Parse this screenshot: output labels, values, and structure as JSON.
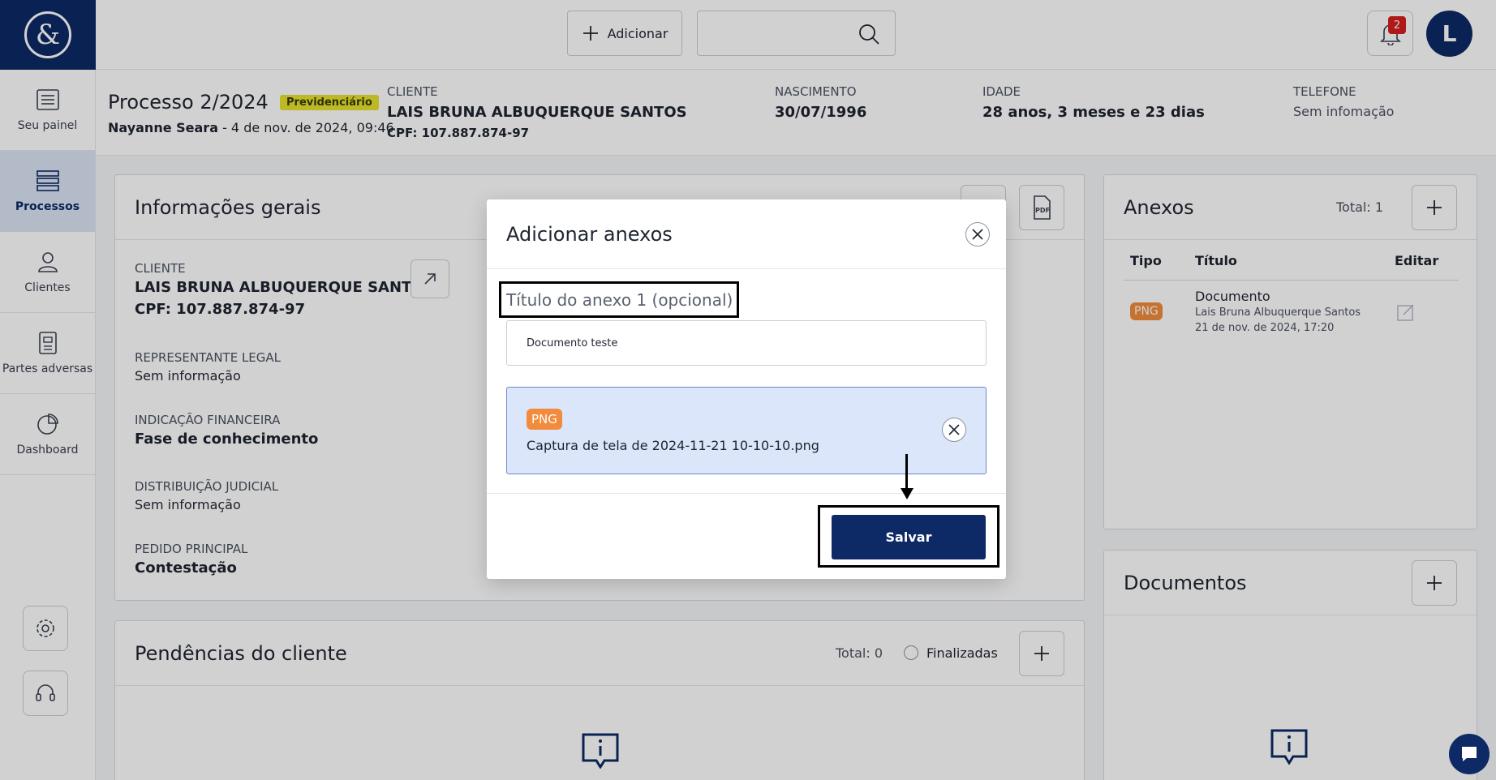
{
  "sidebar": {
    "items": [
      {
        "label": "Seu painel",
        "icon": "dashboard-list-icon"
      },
      {
        "label": "Processos",
        "icon": "stack-icon",
        "active": true
      },
      {
        "label": "Clientes",
        "icon": "person-icon"
      },
      {
        "label": "Partes adversas",
        "icon": "document-icon"
      },
      {
        "label": "Dashboard",
        "icon": "pie-chart-icon"
      }
    ]
  },
  "topbar": {
    "add_label": "Adicionar",
    "search_value": "",
    "notifications_count": "2",
    "avatar_initial": "L"
  },
  "process": {
    "title": "Processo 2/2024",
    "tag": "Previdenciário",
    "author": "Nayanne Seara",
    "date": " - 4 de nov. de 2024, 09:46"
  },
  "header_fields": {
    "cliente_label": "CLIENTE",
    "cliente_name": "LAIS BRUNA ALBUQUERQUE SANTOS",
    "cliente_cpf": "CPF: 107.887.874-97",
    "nascimento_label": "NASCIMENTO",
    "nascimento_value": "30/07/1996",
    "idade_label": "IDADE",
    "idade_value": "28 anos, 3 meses e 23 dias",
    "telefone_label": "TELEFONE",
    "telefone_value": "Sem infomação"
  },
  "info_card": {
    "title": "Informações gerais",
    "cliente_label": "CLIENTE",
    "cliente_name": "LAIS BRUNA ALBUQUERQUE SANTOS",
    "cliente_cpf": "CPF: 107.887.874-97",
    "rep_label": "REPRESENTANTE LEGAL",
    "rep_value": "Sem informação",
    "ind_label": "INDICAÇÃO FINANCEIRA",
    "ind_value": "Fase de conhecimento",
    "dist_label": "DISTRIBUIÇÃO JUDICIAL",
    "dist_value": "Sem informação",
    "pedido_label": "PEDIDO PRINCIPAL",
    "pedido_value": "Contestação"
  },
  "pendencias": {
    "title": "Pendências do cliente",
    "total": "Total: 0",
    "finalizadas": "Finalizadas"
  },
  "anexos": {
    "title": "Anexos",
    "total": "Total: 1",
    "col_tipo": "Tipo",
    "col_titulo": "Título",
    "col_editar": "Editar",
    "row": {
      "type": "PNG",
      "title": "Documento",
      "author": "Lais Bruna Albuquerque Santos",
      "date": "21 de nov. de 2024, 17:20"
    }
  },
  "documentos": {
    "title": "Documentos"
  },
  "modal": {
    "title": "Adicionar anexos",
    "field_label": "Título do anexo 1 (opcional)",
    "field_value": "Documento teste",
    "file_type": "PNG",
    "file_name": "Captura de tela de 2024-11-21 10-10-10.png",
    "save_label": "Salvar"
  },
  "colors": {
    "brand": "#0d2a66",
    "tag_yellow": "#e6e22e",
    "png_orange": "#f28b3c",
    "badge_red": "#d61f1f"
  }
}
